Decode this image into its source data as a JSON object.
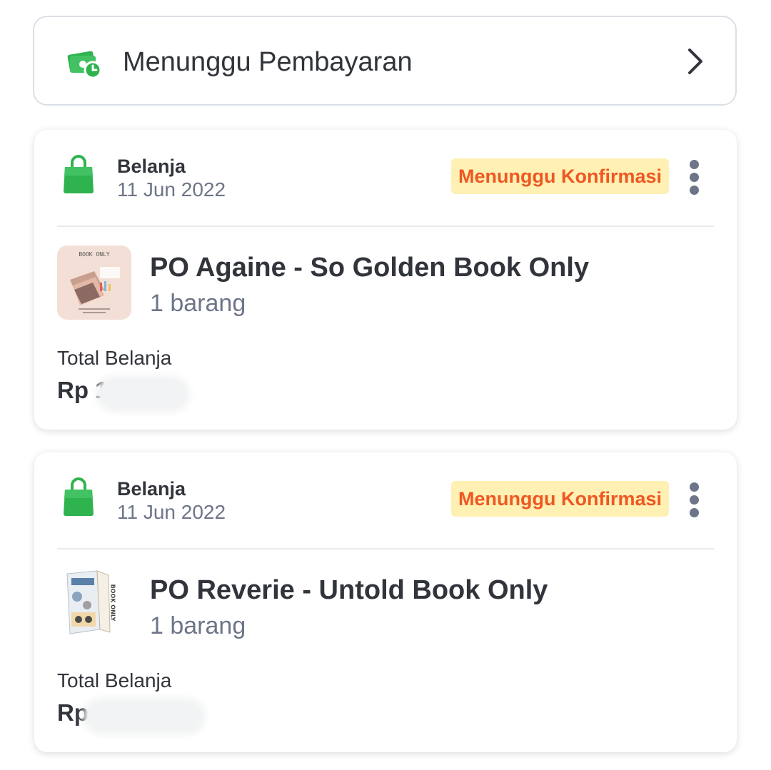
{
  "pending_payment": {
    "label": "Menunggu Pembayaran",
    "icon": "money-clock-icon",
    "arrow_icon": "chevron-right-icon"
  },
  "orders": [
    {
      "category": "Belanja",
      "date": "11 Jun 2022",
      "status": "Menunggu Konfirmasi",
      "product": "PO Againe - So Golden Book Only",
      "quantity": "1 barang",
      "total_label": "Total Belanja",
      "total_value": "Rp 1",
      "thumbnail_text": "BOOK ONLY"
    },
    {
      "category": "Belanja",
      "date": "11 Jun 2022",
      "status": "Menunggu Konfirmasi",
      "product": "PO Reverie - Untold Book Only",
      "quantity": "1 barang",
      "total_label": "Total Belanja",
      "total_value": "Rp",
      "thumbnail_text": "BOOK ONLY"
    }
  ],
  "colors": {
    "green": "#2fb34f",
    "status_bg": "#fff0b3",
    "status_text": "#ef5722",
    "text_primary": "#31353b",
    "text_secondary": "#6d7588"
  }
}
